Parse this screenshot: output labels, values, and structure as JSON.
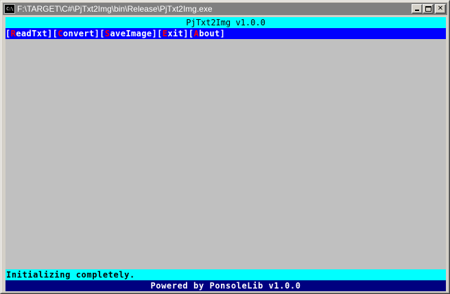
{
  "window": {
    "title": "F:\\TARGET\\C#\\PjTxt2Img\\bin\\Release\\PjTxt2Img.exe",
    "icon": "cmd-icon",
    "icon_label": "C:\\"
  },
  "console": {
    "header": "PjTxt2Img v1.0.0",
    "menu": [
      {
        "hotkey": "R",
        "rest": "eadTxt"
      },
      {
        "hotkey": "C",
        "rest": "onvert"
      },
      {
        "hotkey": "S",
        "rest": "aveImage"
      },
      {
        "hotkey": "E",
        "rest": "xit"
      },
      {
        "hotkey": "A",
        "rest": "bout"
      }
    ],
    "status": "Initializing completely.",
    "footer": "Powered by PonsoleLib v1.0.0"
  },
  "colors": {
    "header_bg": "#00ffff",
    "menu_bg": "#0000ff",
    "hotkey": "#ff0000",
    "body_bg": "#c0c0c0",
    "footer_bg": "#000080"
  }
}
